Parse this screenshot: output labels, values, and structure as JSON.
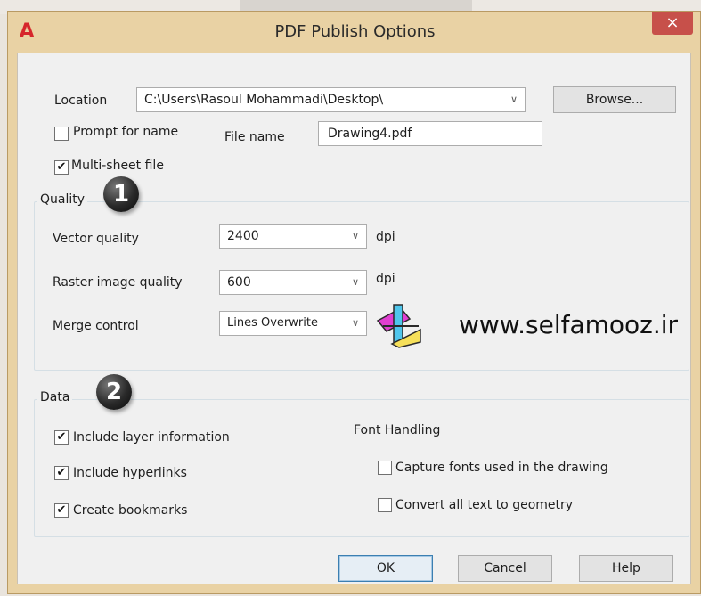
{
  "window": {
    "title": "PDF Publish Options",
    "close_label": "×",
    "logo_glyph": "A"
  },
  "location": {
    "label": "Location",
    "path": "C:\\Users\\Rasoul Mohammadi\\Desktop\\",
    "browse_label": "Browse..."
  },
  "prompt": {
    "label": "Prompt for name",
    "checked": false
  },
  "file": {
    "label": "File name",
    "value": "Drawing4.pdf"
  },
  "multisheet": {
    "label": "Multi-sheet file",
    "checked": true
  },
  "quality": {
    "title": "Quality",
    "badge": "1",
    "vector": {
      "label": "Vector quality",
      "value": "2400",
      "unit": "dpi"
    },
    "raster": {
      "label": "Raster image quality",
      "value": "600",
      "unit": "dpi"
    },
    "merge": {
      "label": "Merge control",
      "value": "Lines Overwrite"
    }
  },
  "watermark": "www.selfamooz.ir",
  "data": {
    "title": "Data",
    "badge": "2",
    "layer": {
      "label": "Include layer information",
      "checked": true
    },
    "hyperlinks": {
      "label": "Include hyperlinks",
      "checked": true
    },
    "bookmarks": {
      "label": "Create bookmarks",
      "checked": true
    },
    "font_handling": {
      "title": "Font Handling",
      "capture": {
        "label": "Capture fonts used in the drawing",
        "checked": false
      },
      "convert": {
        "label": "Convert all text to geometry",
        "checked": false
      }
    }
  },
  "buttons": {
    "ok": "OK",
    "cancel": "Cancel",
    "help": "Help"
  },
  "colors": {
    "close": "#c7504a",
    "logo": "#d6262b",
    "frame": "#e9d2a4"
  },
  "glyphs": {
    "check": "✔",
    "chevron": "∨"
  }
}
